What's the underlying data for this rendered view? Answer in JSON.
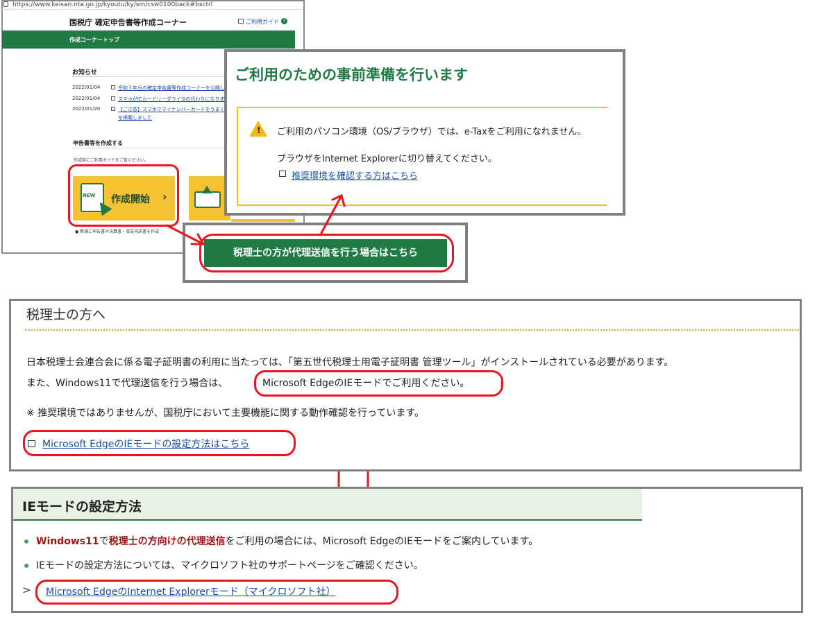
{
  "browser": {
    "url": "https://www.keisan.nta.go.jp/kyoutu/ky/sm/csw0100back#bsctrl",
    "site_title": "国税庁 確定申告書等作成コーナー",
    "guide_link": "ご利用ガイド",
    "nav_label": "作成コーナートップ",
    "notices_title": "お知らせ",
    "notices": [
      {
        "date": "2022/01/04",
        "text": "令和３年分の確定申告書等作成コーナーを公開し"
      },
      {
        "date": "2022/01/04",
        "text": "スマホがICカードリーダライタの代わりになりま"
      },
      {
        "date": "2022/01/20",
        "text": "【ご注意】スマホでマイナンバーカードをうまく"
      }
    ],
    "notice_continuation": "を掲載しました",
    "create_title": "申告書等を作成する",
    "create_note": "作成前にご利用ガイドをご覧ください。",
    "start_icon_text": "NEW",
    "start_label": "作成開始",
    "start_chevron": "›",
    "start_footnote": "● 新規に申告書や決算書・収支内訳書を作成"
  },
  "popup": {
    "title": "ご利用のための事前準備を行います",
    "warning_line1": "ご利用のパソコン環境（OS/ブラウザ）では、e-Taxをご利用になれません。",
    "warning_line2": "ブラウザをInternet Explorerに切り替えてください。",
    "warning_link": "推奨環境を確認する方はこちら"
  },
  "agent_button": {
    "label": "税理士の方が代理送信を行う場合はこちら"
  },
  "tax_accountant": {
    "title": "税理士の方へ",
    "para1": "日本税理士会連合会に係る電子証明書の利用に当たっては、「第五世代税理士用電子証明書 管理ツール」がインストールされている必要があります。",
    "para2_prefix": "また、Windows11で代理送信を行う場合は、",
    "para2_highlight": "Microsoft EdgeのIEモードでご利用ください。",
    "note": "※  推奨環境ではありませんが、国税庁において主要機能に関する動作確認を行っています。",
    "link": "Microsoft EdgeのIEモードの設定方法はこちら"
  },
  "ie_mode": {
    "title": "IEモードの設定方法",
    "bullet1_part1": "Windows11",
    "bullet1_part2": "で",
    "bullet1_part3": "税理士の方向けの代理送信",
    "bullet1_part4": "をご利用の場合には、Microsoft EdgeのIEモードをご案内しています。",
    "bullet2": "IEモードの設定方法については、マイクロソフト社のサポートページをご確認ください。",
    "link_prefix": ">",
    "link": "Microsoft EdgeのInternet Explorerモード（マイクロソフト社）"
  },
  "colors": {
    "green": "#1f7a44",
    "highlight_red": "#e8141e",
    "warning_yellow": "#f0c416",
    "button_yellow": "#f6c234",
    "link_blue": "#1a4ea3"
  }
}
